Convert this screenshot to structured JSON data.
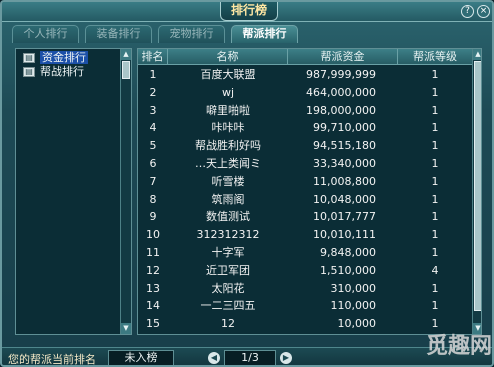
{
  "window": {
    "title": "排行榜",
    "help_icon": "?",
    "close_icon": "×"
  },
  "tabs": [
    {
      "label": "个人排行"
    },
    {
      "label": "装备排行"
    },
    {
      "label": "宠物排行"
    },
    {
      "label": "帮派排行"
    }
  ],
  "sidebar": {
    "items": [
      {
        "label": "资金排行"
      },
      {
        "label": "帮战排行"
      }
    ]
  },
  "table": {
    "columns": [
      "排名",
      "名称",
      "帮派资金",
      "帮派等级"
    ],
    "rows": [
      {
        "rank": "1",
        "name": "百度大联盟",
        "funds": "987,999,999",
        "level": "1"
      },
      {
        "rank": "2",
        "name": "wj",
        "funds": "464,000,000",
        "level": "1"
      },
      {
        "rank": "3",
        "name": "噼里啪啦",
        "funds": "198,000,000",
        "level": "1"
      },
      {
        "rank": "4",
        "name": "咔咔咔",
        "funds": "99,710,000",
        "level": "1"
      },
      {
        "rank": "5",
        "name": "帮战胜利好吗",
        "funds": "94,515,180",
        "level": "1"
      },
      {
        "rank": "6",
        "name": "…天上类闻ミ",
        "funds": "33,340,000",
        "level": "1"
      },
      {
        "rank": "7",
        "name": "听雪楼",
        "funds": "11,008,800",
        "level": "1"
      },
      {
        "rank": "8",
        "name": "筑雨阁",
        "funds": "10,048,000",
        "level": "1"
      },
      {
        "rank": "9",
        "name": "数值测试",
        "funds": "10,017,777",
        "level": "1"
      },
      {
        "rank": "10",
        "name": "312312312",
        "funds": "10,010,111",
        "level": "1"
      },
      {
        "rank": "11",
        "name": "十字军",
        "funds": "9,848,000",
        "level": "1"
      },
      {
        "rank": "12",
        "name": "近卫军团",
        "funds": "1,510,000",
        "level": "4"
      },
      {
        "rank": "13",
        "name": "太阳花",
        "funds": "310,000",
        "level": "1"
      },
      {
        "rank": "14",
        "name": "一二三四五",
        "funds": "110,000",
        "level": "1"
      },
      {
        "rank": "15",
        "name": "12",
        "funds": "10,000",
        "level": "1"
      }
    ]
  },
  "footer": {
    "label": "您的帮派当前排名",
    "value": "未入榜",
    "page": "1/3"
  },
  "watermark": "觅趣网",
  "colors": {
    "window_bg": "#1d4a55",
    "title_text": "#ffe7a3",
    "selected_item": "#1c50a8"
  }
}
